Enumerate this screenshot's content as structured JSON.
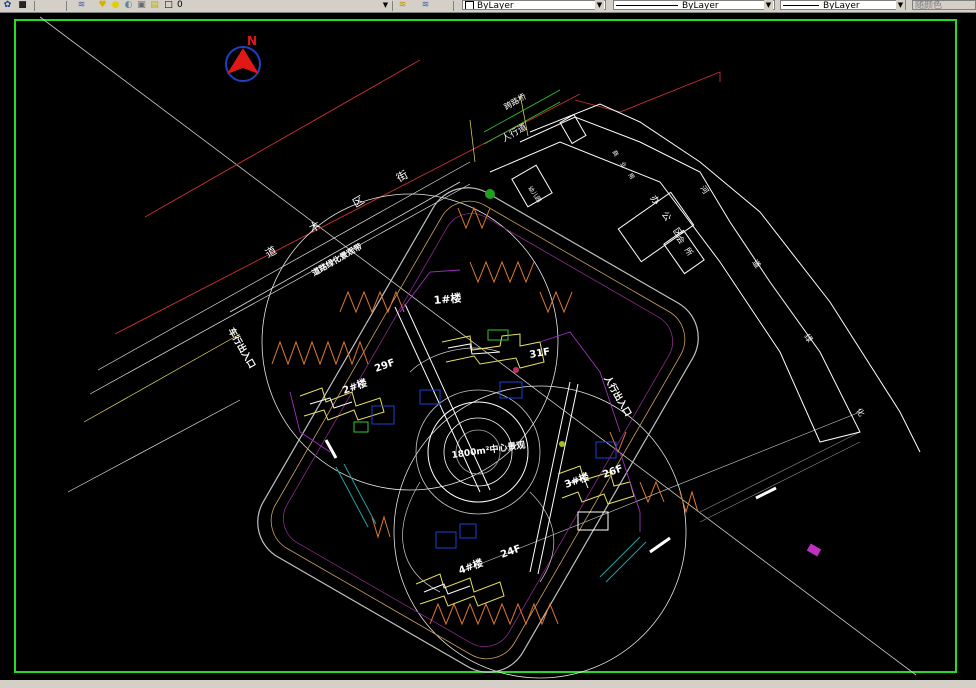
{
  "toolbar": {
    "layer_value": "0",
    "color_value": "ByLayer",
    "linetype_value": "ByLayer",
    "lineweight_value": "ByLayer",
    "plotstyle_label": "随颜色"
  },
  "drawing": {
    "north_label": "N",
    "labels": {
      "tower_1": "1#楼",
      "tower_2": "2#楼",
      "tower_3": "3#楼",
      "tower_4": "4#楼",
      "floors_31f": "31F",
      "floors_29f": "29F",
      "floors_26f": "26F",
      "floors_24f": "24F",
      "plaza": "1800m²中心景观",
      "entrance_east": "人行出入口",
      "entrance_west": "车行出入口",
      "road_name": "道 木 区 街",
      "greenbelt": "道路绿化景观带",
      "crosswalk": "人行道",
      "office": "办 公 区",
      "club": "会 所",
      "kindergarten": "幼儿园",
      "commerce": "商 业 用",
      "river": "河 道 绿 化",
      "footbridge": "跨路桥"
    }
  }
}
